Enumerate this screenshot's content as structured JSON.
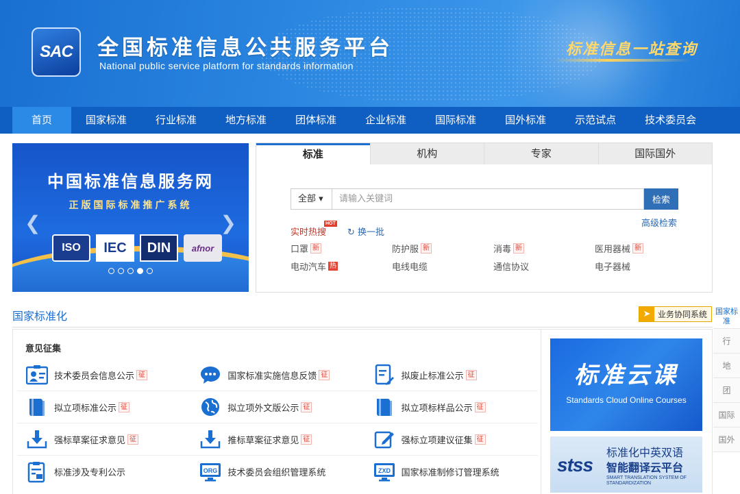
{
  "header": {
    "logo_text": "SAC",
    "title": "全国标准信息公共服务平台",
    "subtitle": "National public service platform  for standards information",
    "slogan": "标准信息一站查询"
  },
  "nav": {
    "items": [
      {
        "label": "首页",
        "active": true
      },
      {
        "label": "国家标准"
      },
      {
        "label": "行业标准"
      },
      {
        "label": "地方标准"
      },
      {
        "label": "团体标准"
      },
      {
        "label": "企业标准"
      },
      {
        "label": "国际标准"
      },
      {
        "label": "国外标准"
      },
      {
        "label": "示范试点"
      },
      {
        "label": "技术委员会"
      }
    ]
  },
  "banner": {
    "title": "中国标准信息服务网",
    "subtitle": "正版国际标准推广系统",
    "logos": [
      "ISO",
      "IEC",
      "DIN",
      "afnor"
    ],
    "prev_icon": "chevron-left-icon",
    "next_icon": "chevron-right-icon",
    "slide_count": 5,
    "active_slide": 4
  },
  "search": {
    "tabs": [
      {
        "label": "标准",
        "active": true
      },
      {
        "label": "机构"
      },
      {
        "label": "专家"
      },
      {
        "label": "国际国外"
      }
    ],
    "scope": "全部",
    "placeholder": "请输入关键词",
    "button": "检索",
    "advanced": "高级检索",
    "hot_label": "实时热搜",
    "hot_badge": "HOT",
    "refresh": "换一批",
    "hot_items": [
      {
        "label": "口罩",
        "tag": "新",
        "tag_type": "new"
      },
      {
        "label": "防护服",
        "tag": "新",
        "tag_type": "new"
      },
      {
        "label": "消毒",
        "tag": "新",
        "tag_type": "new"
      },
      {
        "label": "医用器械",
        "tag": "新",
        "tag_type": "new"
      },
      {
        "label": "电动汽车",
        "tag": "热",
        "tag_type": "hot"
      },
      {
        "label": "电线电缆",
        "tag": "",
        "tag_type": ""
      },
      {
        "label": "通信协议",
        "tag": "",
        "tag_type": ""
      },
      {
        "label": "电子器械",
        "tag": "",
        "tag_type": ""
      }
    ]
  },
  "section": {
    "title": "国家标准化",
    "biz_button": "业务协同系统"
  },
  "side_nav": {
    "items": [
      {
        "label": "国家标准",
        "active": true
      },
      {
        "label": "行"
      },
      {
        "label": "地"
      },
      {
        "label": "团"
      },
      {
        "label": "国际"
      },
      {
        "label": "国外"
      }
    ]
  },
  "opinion": {
    "title": "意见征集",
    "rows": [
      [
        {
          "label": "技术委员会信息公示",
          "tag": "征",
          "icon": "id-card-icon"
        },
        {
          "label": "国家标准实施信息反馈",
          "tag": "征",
          "icon": "chat-bubble-icon"
        },
        {
          "label": "拟废止标准公示",
          "tag": "征",
          "icon": "document-edit-icon"
        }
      ],
      [
        {
          "label": "拟立项标准公示",
          "tag": "征",
          "icon": "book-icon"
        },
        {
          "label": "拟立项外文版公示",
          "tag": "征",
          "icon": "globe-icon"
        },
        {
          "label": "拟立项标样品公示",
          "tag": "征",
          "icon": "book-icon"
        }
      ],
      [
        {
          "label": "强标草案征求意见",
          "tag": "征",
          "icon": "download-tray-icon"
        },
        {
          "label": "推标草案征求意见",
          "tag": "征",
          "icon": "download-tray-icon"
        },
        {
          "label": "强标立项建议征集",
          "tag": "征",
          "icon": "pencil-square-icon"
        }
      ],
      [
        {
          "label": "标准涉及专利公示",
          "tag": "",
          "icon": "patent-document-icon"
        },
        {
          "label": "技术委员会组织管理系统",
          "tag": "",
          "icon": "org-monitor-icon",
          "badge": "ORG"
        },
        {
          "label": "国家标准制修订管理系统",
          "tag": "",
          "icon": "zxd-monitor-icon",
          "badge": "ZXD"
        }
      ]
    ]
  },
  "ads": {
    "ad1_title": "标准云课",
    "ad1_sub": "Standards Cloud Online Courses",
    "ad2_logo": "stss",
    "ad2_line1": "标准化中英双语",
    "ad2_line2": "智能翻译云平台",
    "ad2_line3": "SMART TRANSLATION SYSTEM OF STANDARDIZATION"
  },
  "colors": {
    "primary": "#1a6fd1",
    "nav_bg": "#0f5fc2",
    "nav_active": "#2b8ae6",
    "search_button": "#2f6fb8",
    "tag_red": "#e34234",
    "slogan_gold": "#ffd86b"
  }
}
